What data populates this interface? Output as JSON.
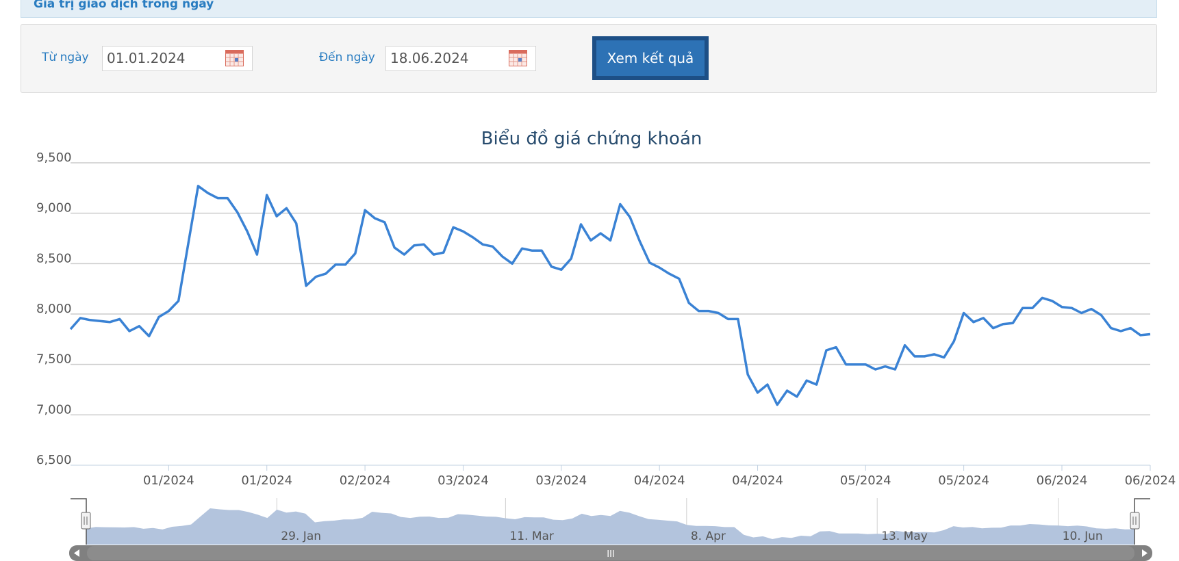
{
  "header": {
    "title": "Giá trị giao dịch trong ngày"
  },
  "filters": {
    "from_label": "Từ ngày",
    "from_value": "01.01.2024",
    "to_label": "Đến ngày",
    "to_value": "18.06.2024",
    "submit_label": "Xem kết quả"
  },
  "colors": {
    "line": "#3a82d4",
    "navigator_fill": "#b3c4dd",
    "accent": "#2a7dc1"
  },
  "chart_data": {
    "type": "line",
    "title": "Biểu đồ giá chứng khoán",
    "xlabel": "",
    "ylabel": "",
    "ylim": [
      6500,
      9500
    ],
    "yticks": [
      "9,500",
      "9,000",
      "8,500",
      "8,000",
      "7,500",
      "7,000",
      "6,500"
    ],
    "ytick_values": [
      9500,
      9000,
      8500,
      8000,
      7500,
      7000,
      6500
    ],
    "grid": true,
    "legend": "none",
    "xticks": [
      "01/2024",
      "01/2024",
      "02/2024",
      "03/2024",
      "03/2024",
      "04/2024",
      "04/2024",
      "05/2024",
      "05/2024",
      "06/2024",
      "06/2024"
    ],
    "xtick_index": [
      10,
      20,
      30,
      40,
      50,
      60,
      70,
      81,
      91,
      101,
      110
    ],
    "series": [
      {
        "values": [
          7850,
          7960,
          7940,
          7930,
          7920,
          7950,
          7830,
          7880,
          7780,
          7970,
          8030,
          8130,
          8700,
          9270,
          9200,
          9150,
          9150,
          9010,
          8820,
          8590,
          9180,
          8970,
          9050,
          8900,
          8280,
          8370,
          8400,
          8490,
          8490,
          8600,
          9030,
          8950,
          8910,
          8660,
          8590,
          8680,
          8690,
          8590,
          8610,
          8860,
          8820,
          8760,
          8690,
          8670,
          8570,
          8500,
          8650,
          8630,
          8630,
          8470,
          8440,
          8550,
          8890,
          8730,
          8800,
          8730,
          9090,
          8960,
          8720,
          8510,
          8460,
          8400,
          8350,
          8110,
          8030,
          8030,
          8010,
          7950,
          7950,
          7400,
          7220,
          7300,
          7100,
          7240,
          7180,
          7340,
          7300,
          7640,
          7670,
          7500,
          7500,
          7500,
          7450,
          7480,
          7450,
          7690,
          7580,
          7580,
          7600,
          7570,
          7730,
          8010,
          7920,
          7960,
          7860,
          7900,
          7910,
          8060,
          8060,
          8160,
          8130,
          8070,
          8060,
          8010,
          8050,
          7990,
          7860,
          7830,
          7860,
          7790,
          7800
        ]
      }
    ],
    "navigator": {
      "labels": [
        "29. Jan",
        "11. Mar",
        "8. Apr",
        "13. May",
        "10. Jun"
      ],
      "label_index": [
        20,
        44,
        63,
        83,
        102
      ],
      "scrollbar_grip": "III"
    }
  }
}
